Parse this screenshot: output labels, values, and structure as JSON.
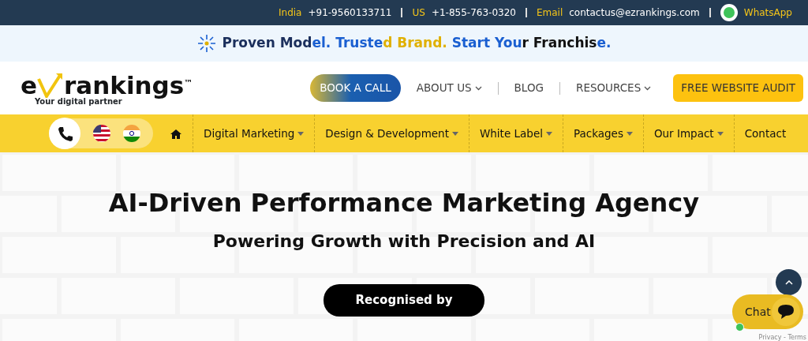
{
  "topbar": {
    "contacts": [
      {
        "label": "India",
        "value": "+91-9560133711"
      },
      {
        "label": "US",
        "value": "+1-855-763-0320"
      },
      {
        "label": "Email",
        "value": "contactus@ezrankings.com"
      }
    ],
    "whatsapp": "WhatsApp"
  },
  "banner": {
    "segments": [
      {
        "text": "Proven Mod",
        "color": "#1b2f5c"
      },
      {
        "text": "el. Truste",
        "color": "#1a5fd1"
      },
      {
        "text": "d Brand. ",
        "color": "#e0b000"
      },
      {
        "text": "Start You",
        "color": "#1a5fd1"
      },
      {
        "text": "r Franchis",
        "color": "#111111"
      },
      {
        "text": "e.",
        "color": "#1a5fd1"
      }
    ]
  },
  "header": {
    "logo": {
      "wordmark": "rankings",
      "prefix": "e",
      "tm": "™",
      "tagline": "Your digital partner"
    },
    "book_call": "BOOK A CALL",
    "links": [
      {
        "label": "ABOUT US",
        "dropdown": true
      },
      {
        "label": "BLOG",
        "dropdown": false
      },
      {
        "label": "RESOURCES",
        "dropdown": true
      }
    ],
    "audit": "FREE WEBSITE AUDIT"
  },
  "nav": {
    "items": [
      {
        "label": "Digital Marketing",
        "dropdown": true
      },
      {
        "label": "Design & Development",
        "dropdown": true
      },
      {
        "label": "White Label",
        "dropdown": true
      },
      {
        "label": "Packages",
        "dropdown": true
      },
      {
        "label": "Our Impact",
        "dropdown": true
      },
      {
        "label": "Contact",
        "dropdown": false
      }
    ]
  },
  "hero": {
    "title": "AI-Driven Performance Marketing Agency",
    "subtitle": "Powering Growth with Precision and AI",
    "badge": "Recognised by"
  },
  "chat": {
    "label": "Chat",
    "online": true
  },
  "recaptcha": "Privacy - Terms"
}
